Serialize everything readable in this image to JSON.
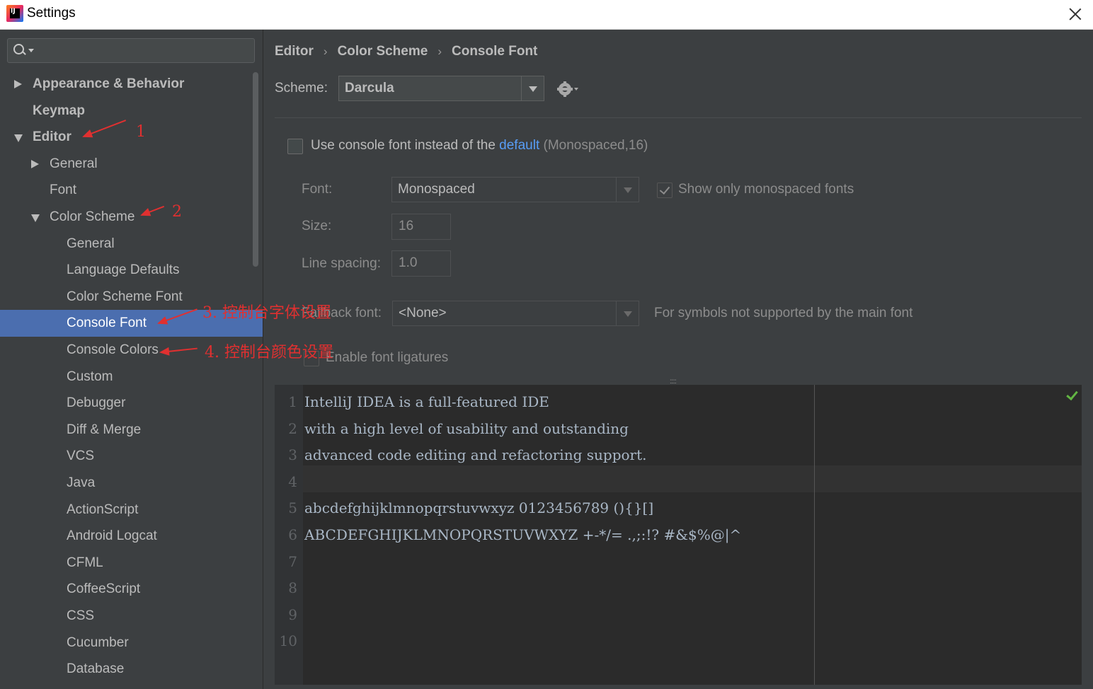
{
  "window": {
    "title": "Settings",
    "app_icon": "intellij-idea-icon"
  },
  "search": {
    "placeholder": "",
    "value": ""
  },
  "sidebar": {
    "items": [
      {
        "label": "Appearance & Behavior",
        "level": 0,
        "expander": "collapsed",
        "bold": true
      },
      {
        "label": "Keymap",
        "level": 0,
        "expander": "none",
        "bold": true
      },
      {
        "label": "Editor",
        "level": 0,
        "expander": "expanded",
        "bold": true
      },
      {
        "label": "General",
        "level": 1,
        "expander": "collapsed"
      },
      {
        "label": "Font",
        "level": 1,
        "expander": "none"
      },
      {
        "label": "Color Scheme",
        "level": 1,
        "expander": "expanded"
      },
      {
        "label": "General",
        "level": 2,
        "expander": "none"
      },
      {
        "label": "Language Defaults",
        "level": 2,
        "expander": "none"
      },
      {
        "label": "Color Scheme Font",
        "level": 2,
        "expander": "none"
      },
      {
        "label": "Console Font",
        "level": 2,
        "expander": "none",
        "selected": true
      },
      {
        "label": "Console Colors",
        "level": 2,
        "expander": "none"
      },
      {
        "label": "Custom",
        "level": 2,
        "expander": "none"
      },
      {
        "label": "Debugger",
        "level": 2,
        "expander": "none"
      },
      {
        "label": "Diff & Merge",
        "level": 2,
        "expander": "none"
      },
      {
        "label": "VCS",
        "level": 2,
        "expander": "none"
      },
      {
        "label": "Java",
        "level": 2,
        "expander": "none"
      },
      {
        "label": "ActionScript",
        "level": 2,
        "expander": "none"
      },
      {
        "label": "Android Logcat",
        "level": 2,
        "expander": "none"
      },
      {
        "label": "CFML",
        "level": 2,
        "expander": "none"
      },
      {
        "label": "CoffeeScript",
        "level": 2,
        "expander": "none"
      },
      {
        "label": "CSS",
        "level": 2,
        "expander": "none"
      },
      {
        "label": "Cucumber",
        "level": 2,
        "expander": "none"
      },
      {
        "label": "Database",
        "level": 2,
        "expander": "none"
      }
    ]
  },
  "annotations": {
    "a1": "1",
    "a2": "2",
    "a3": "3. 控制台字体设置",
    "a4": "4. 控制台颜色设置",
    "color": "#e03030"
  },
  "breadcrumb": {
    "c1": "Editor",
    "sep": "›",
    "c2": "Color Scheme",
    "c3": "Console Font"
  },
  "scheme": {
    "label": "Scheme:",
    "value": "Darcula"
  },
  "use_console_font": {
    "checked": false,
    "text_before": "Use console font instead of the ",
    "link": "default",
    "text_after": " (Monospaced,16)"
  },
  "font": {
    "label": "Font:",
    "value": "Monospaced"
  },
  "show_monospaced": {
    "checked": true,
    "label": "Show only monospaced fonts"
  },
  "size": {
    "label": "Size:",
    "value": "16"
  },
  "line_spacing": {
    "label": "Line spacing:",
    "value": "1.0"
  },
  "fallback": {
    "label": "Fallback font:",
    "value": "<None>",
    "hint": "For symbols not supported by the main font"
  },
  "ligatures": {
    "checked": false,
    "label": "Enable font ligatures"
  },
  "preview": {
    "lines": [
      {
        "n": "1",
        "text": "IntelliJ IDEA is a full-featured IDE"
      },
      {
        "n": "2",
        "text": "with a high level of usability and outstanding"
      },
      {
        "n": "3",
        "text": "advanced code editing and refactoring support."
      },
      {
        "n": "4",
        "text": ""
      },
      {
        "n": "5",
        "text": "abcdefghijklmnopqrstuvwxyz 0123456789 (){}[]"
      },
      {
        "n": "6",
        "text": "ABCDEFGHIJKLMNOPQRSTUVWXYZ +-*/= .,;:!? #&$%@|^"
      },
      {
        "n": "7",
        "text": ""
      },
      {
        "n": "8",
        "text": ""
      },
      {
        "n": "9",
        "text": ""
      },
      {
        "n": "10",
        "text": ""
      }
    ],
    "status_icon": "inspection-ok-icon"
  }
}
